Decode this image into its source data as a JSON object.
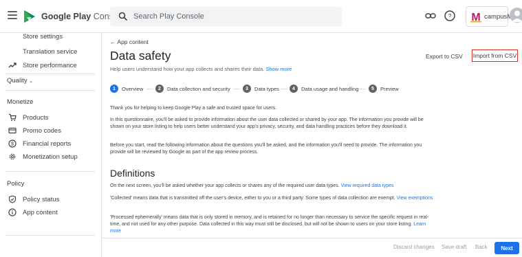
{
  "header": {
    "brand_strong": "Google Play",
    "brand_light": "Console",
    "search_placeholder": "Search Play Console",
    "account_name": "campusM",
    "account_initial": "M"
  },
  "sidebar": {
    "top_items": [
      {
        "label": "Store settings"
      },
      {
        "label": "Translation service"
      },
      {
        "label": "Store performance",
        "icon": "trending-up-icon"
      }
    ],
    "sections": {
      "quality": "Quality",
      "monetize": "Monetize",
      "policy": "Policy"
    },
    "monetize_items": [
      {
        "label": "Products",
        "icon": "cart-icon"
      },
      {
        "label": "Promo codes",
        "icon": "ticket-icon"
      },
      {
        "label": "Financial reports",
        "icon": "dollar-icon"
      },
      {
        "label": "Monetization setup",
        "icon": "gear-icon"
      }
    ],
    "policy_items": [
      {
        "label": "Policy status",
        "icon": "shield-check-icon"
      },
      {
        "label": "App content",
        "icon": "info-icon"
      }
    ]
  },
  "main": {
    "back_link": "App content",
    "title": "Data safety",
    "subtitle": "Help users understand how your app collects and shares their data.",
    "show_more": "Show more",
    "export_csv": "Export to CSV",
    "import_csv": "Import from CSV",
    "steps": [
      {
        "num": "1",
        "label": "Overview"
      },
      {
        "num": "2",
        "label": "Data collection and security"
      },
      {
        "num": "3",
        "label": "Data types"
      },
      {
        "num": "4",
        "label": "Data usage and handling"
      },
      {
        "num": "5",
        "label": "Preview"
      }
    ],
    "intro_1": "Thank you for helping to keep Google Play a safe and trusted space for users.",
    "intro_2": "In this questionnaire, you'll be asked to provide information about the user data collected or shared by your app. The information you provide will be shown on your store listing to help users better understand your app's privacy, security, and data handling practices before they download it.",
    "intro_3": "Before you start, read the following information about the questions you'll be asked, and the information you'll need to provide. The information you provide will be reviewed by Google as part of the app review process.",
    "definitions_title": "Definitions",
    "def_1": "On the next screen, you'll be asked whether your app collects or shares any of the required user data types.",
    "def_1_link": "View required data types",
    "def_2": "'Collected' means data that is transmitted off the user's device, either to you or a third party. Some types of data collection are exempt.",
    "def_2_link": "View exemptions",
    "def_3": "'Processed ephemerally' means data that is only stored in memory, and is retained for no longer than necessary to service the specific request in real-time, and not used for any other purpose. Data collected in this way must still be disclosed, but will not be shown to users on your store listing.",
    "def_3_link": "Learn more"
  },
  "footer": {
    "discard": "Discard changes",
    "save_draft": "Save draft",
    "back": "Back",
    "next": "Next"
  },
  "colors": {
    "accent": "#1a73e8",
    "highlight_border": "#d93025"
  }
}
